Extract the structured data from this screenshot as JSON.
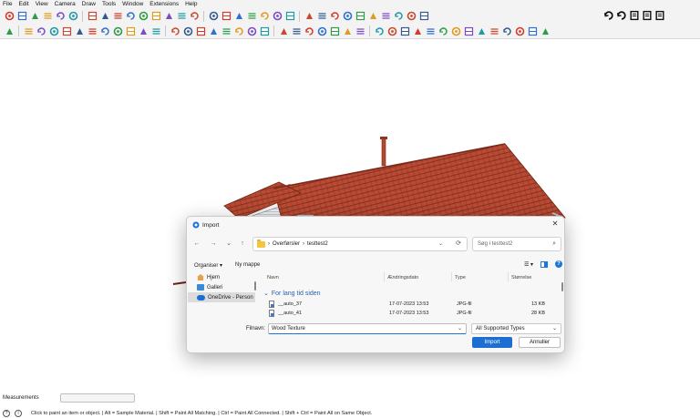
{
  "menu": [
    "File",
    "Edit",
    "View",
    "Camera",
    "Draw",
    "Tools",
    "Window",
    "Extensions",
    "Help"
  ],
  "toolbar1": {
    "icons": [
      "orbit-icon",
      "pan-icon",
      "lasso-icon",
      "paint-icon",
      "axes-icon",
      "text-a-icon",
      "rotate-icon",
      "pushpull-icon",
      "zoom-icon",
      "zoom-extents-icon",
      "section-icon",
      "tape-icon",
      "protractor-icon",
      "section-plane-icon",
      "walk-icon",
      "iso-view-icon",
      "top-view-icon",
      "front-view-icon",
      "right-view-icon",
      "back-view-icon",
      "left-view-icon",
      "bottom-view-icon",
      "xray-icon",
      "wireframe-icon",
      "hidden-line-icon",
      "shaded-icon",
      "textured-icon",
      "monochrome-icon",
      "shadow-icon",
      "fog-icon",
      "style-icon",
      "profile-icon"
    ],
    "right_icons": [
      "sync-icon",
      "sync-alt-icon",
      "plug-icon",
      "export-icon",
      "document-icon"
    ]
  },
  "toolbar2": {
    "icons": [
      "search-icon",
      "select-icon",
      "eraser-icon",
      "pencil-icon",
      "arc-icon",
      "rectangle-icon",
      "pushpull-icon",
      "move-icon",
      "rotate-icon",
      "scale-icon",
      "offset-icon",
      "tape-icon",
      "dimension-icon",
      "protractor-icon",
      "text-icon",
      "axes-icon",
      "3dtext-icon",
      "zoom-icon",
      "zoom-window-icon",
      "orbit-icon",
      "section-icon",
      "components-icon",
      "groups-icon",
      "materials-icon",
      "layers-icon",
      "scenes-icon",
      "outliner-icon",
      "warehouse-icon",
      "extension-icon",
      "ruby-icon",
      "hammer-icon",
      "sandbox-icon",
      "solid-icon",
      "terrain-icon",
      "camera-icon",
      "car-icon",
      "bus-icon",
      "flag-icon",
      "wand-icon",
      "scissors-icon",
      "film-icon"
    ]
  },
  "dialog": {
    "title": "Import",
    "close": "✕",
    "nav": {
      "back": "←",
      "forward": "→",
      "down": "⌄",
      "up": "↑"
    },
    "breadcrumb": [
      "Overførsler",
      "testtest2"
    ],
    "breadcrumb_sep": "›",
    "search_placeholder": "Søg i testtest2",
    "organize": "Organiser ▾",
    "new_folder": "Ny mappe",
    "view_menu": "☰ ▾",
    "help": "?",
    "nav_items": [
      {
        "label": "Hjem",
        "selected": false
      },
      {
        "label": "Galleri",
        "selected": false
      },
      {
        "label": "OneDrive - Person",
        "selected": true
      }
    ],
    "columns": {
      "name": "Navn",
      "date": "Ændringsdato",
      "type": "Type",
      "size": "Størrelse"
    },
    "group": "For lang tid siden",
    "files": [
      {
        "name": "__auto_37",
        "date": "17-07-2023 13:53",
        "type": "JPG-fil",
        "size": "13 KB"
      },
      {
        "name": "__auto_41",
        "date": "17-07-2023 13:53",
        "type": "JPG-fil",
        "size": "28 KB"
      }
    ],
    "filename_label": "Filnavn:",
    "filename_value": "Wood Texture",
    "filter": "All Supported Types",
    "import_btn": "Import",
    "cancel_btn": "Annuller"
  },
  "measurements": {
    "label": "Measurements",
    "value": ""
  },
  "status_bar": {
    "help_icon": "?",
    "info_icon": "i",
    "text": "Click to paint an item or object. | Alt = Sample Material. | Shift = Paint All Matching. | Ctrl = Paint All Connected. | Shift + Ctrl = Paint All on Same Object."
  },
  "colors": {
    "roof": "#b94b34",
    "wall": "#e9eef4",
    "accent": "#1c6fd1"
  }
}
